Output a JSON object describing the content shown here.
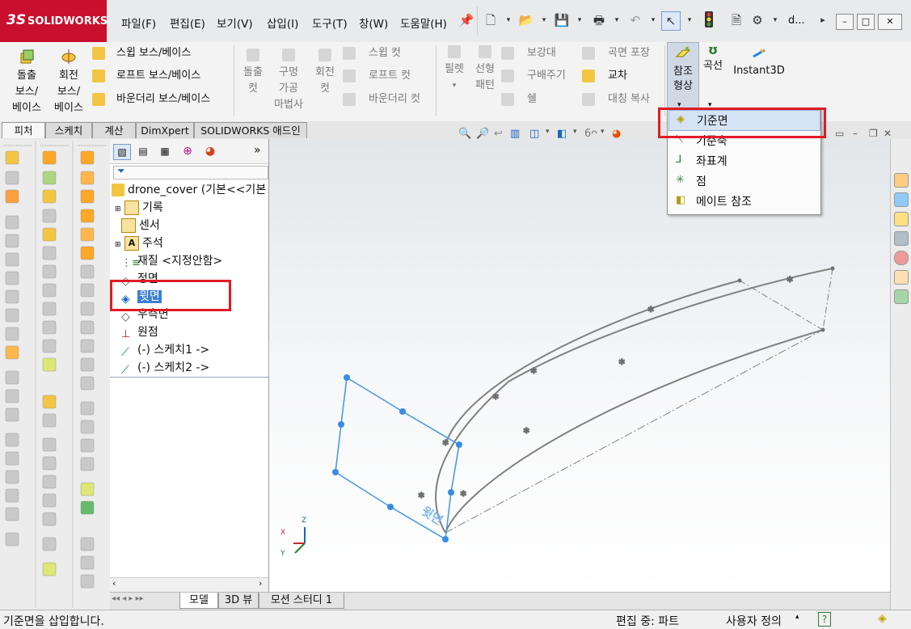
{
  "app": {
    "logo_ds": "3S",
    "logo_text": "SOLIDWORKS",
    "title_short": "d..."
  },
  "menu": [
    "파일(F)",
    "편집(E)",
    "보기(V)",
    "삽입(I)",
    "도구(T)",
    "창(W)",
    "도움말(H)"
  ],
  "ribbon": {
    "extrude_boss": "돌출\n보스/\n베이스",
    "revolve_boss": "회전\n보스/\n베이스",
    "sweep_boss": "스윕 보스/베이스",
    "loft_boss": "로프트 보스/베이스",
    "boundary_boss": "바운더리 보스/베이스",
    "extrude_cut": "돌출\n컷",
    "hole_wizard": "구멍\n가공\n마법사",
    "revolve_cut": "회전\n컷",
    "sweep_cut": "스윕 컷",
    "loft_cut": "로프트 컷",
    "boundary_cut": "바운더리 컷",
    "fillet": "필렛",
    "linear_pattern": "선형\n패턴",
    "rib": "보강대",
    "draft": "구배주기",
    "shell": "쉘",
    "wrap": "곡면 포장",
    "intersect": "교차",
    "mirror": "대칭 복사",
    "ref_geometry": "참조\n형상",
    "curves": "곡선",
    "instant3d": "Instant3D"
  },
  "tabs": [
    "피처",
    "스케치",
    "계산",
    "DimXpert",
    "SOLIDWORKS 애드인"
  ],
  "tree": {
    "root": "drone_cover  (기본<<기본",
    "items": [
      "기록",
      "센서",
      "주석",
      "재질 <지정안함>",
      "정면",
      "윗면",
      "우측면",
      "원점",
      "(-) 스케치1 ->",
      "(-) 스케치2 ->"
    ]
  },
  "dropdown": {
    "items": [
      "기준면",
      "기준축",
      "좌표계",
      "점",
      "메이트 참조"
    ]
  },
  "viewport": {
    "plane_label": "윗면",
    "axis_x": "X",
    "axis_y": "Y",
    "axis_z": "Z"
  },
  "bottom_tabs": [
    "모델",
    "3D 뷰",
    "모션 스터디 1"
  ],
  "status": {
    "message": "기준면을 삽입합니다.",
    "editing": "편집 중: 파트",
    "custom": "사용자 정의"
  },
  "colors": {
    "brand": "#c8102e",
    "highlight": "#e01b24",
    "selection": "#3b7fd4",
    "sketch": "#4a9be8"
  }
}
